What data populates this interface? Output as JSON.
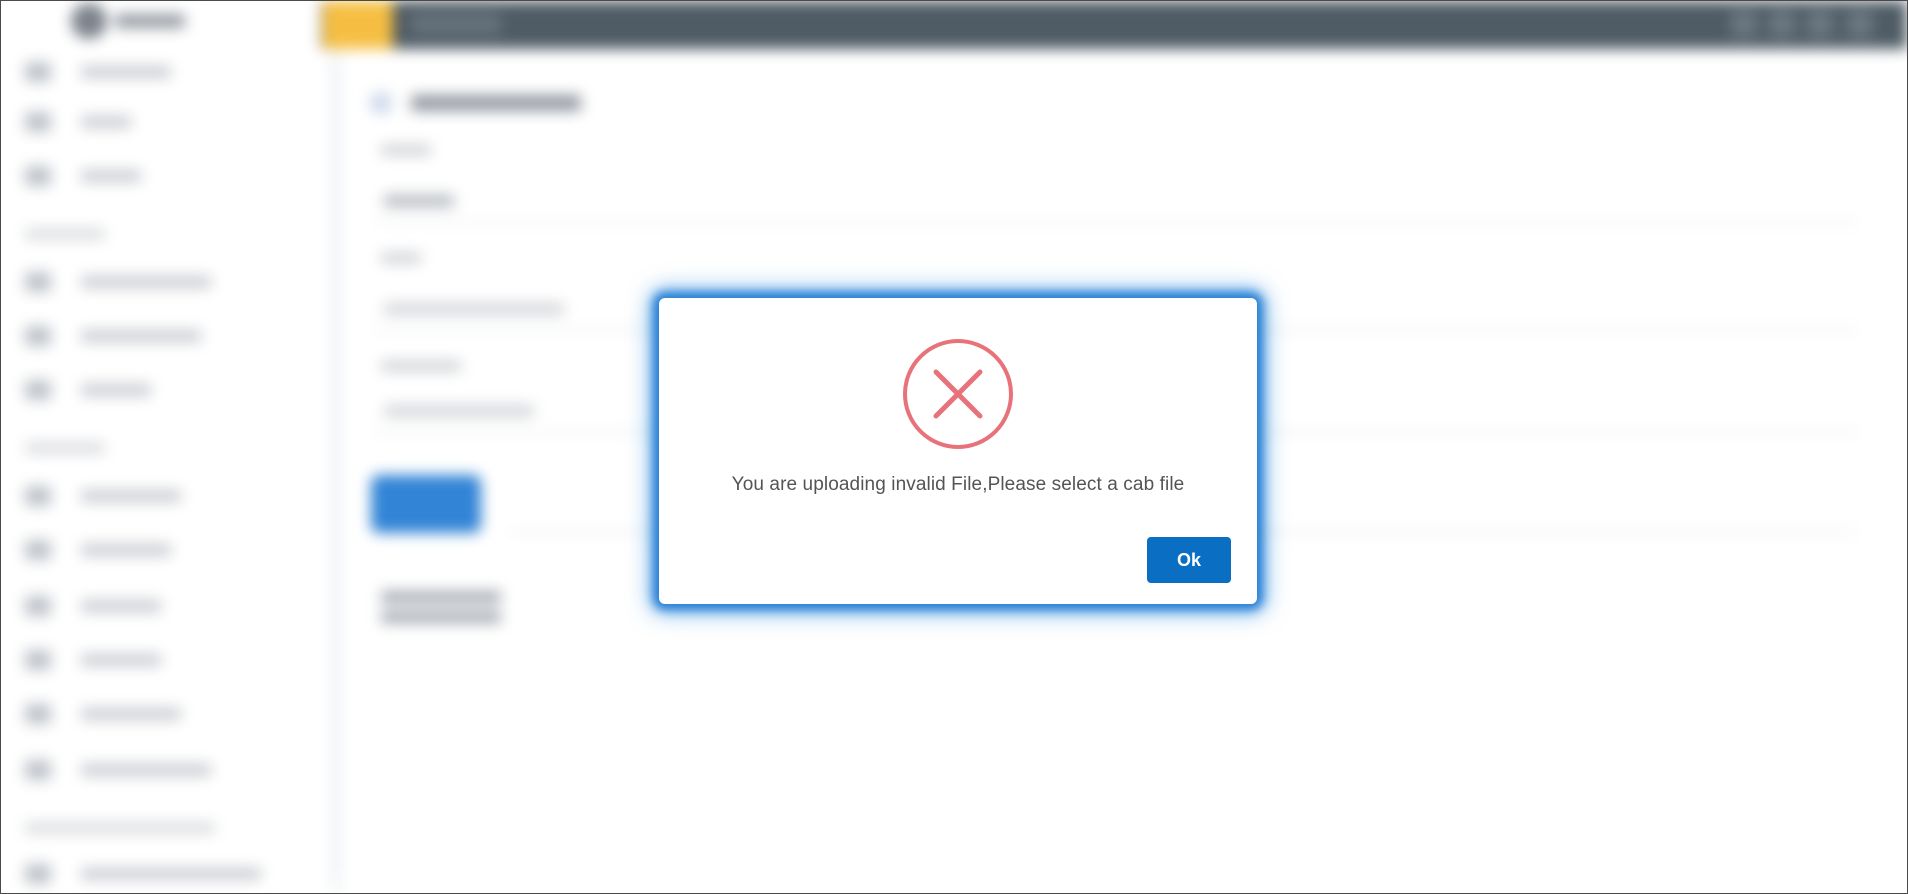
{
  "dialog": {
    "icon": "error-x-circle-icon",
    "message": "You are uploading invalid File,Please select a cab file",
    "ok_label": "Ok",
    "colors": {
      "icon": "#e8727a",
      "button": "#0a6ec2",
      "glow": "#1e78d2"
    }
  }
}
